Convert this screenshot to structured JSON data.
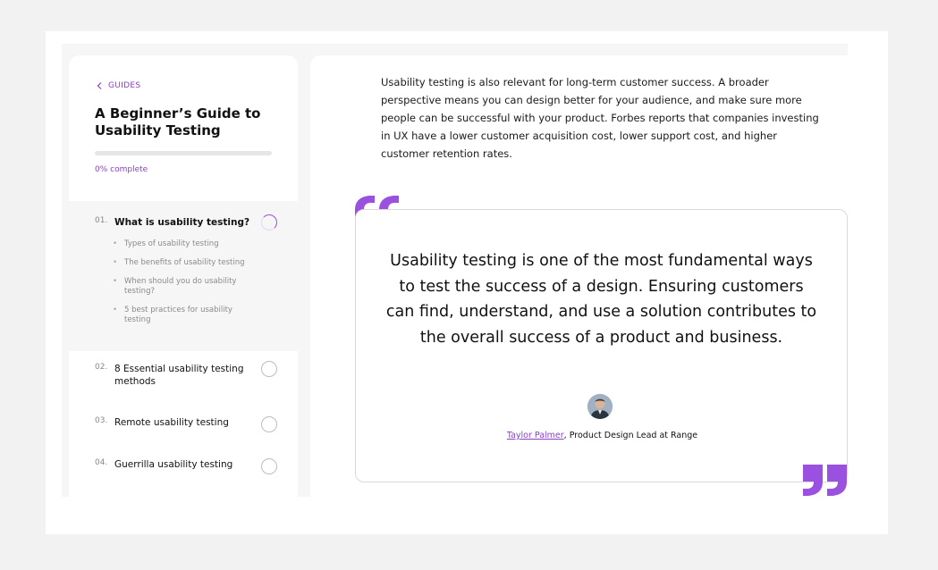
{
  "sidebar": {
    "back_label": "GUIDES",
    "title": "A Beginner’s Guide to Usability Testing",
    "progress_fraction": 0.0,
    "progress_text": "0% complete",
    "chapters": [
      {
        "number": "01.",
        "title": "What is usability testing?",
        "active": true,
        "subsections": [
          "Types of usability testing",
          "The benefits of  usability testing",
          "When should you do usability testing?",
          "5 best practices for usability testing"
        ]
      },
      {
        "number": "02.",
        "title": "8 Essential usability testing methods",
        "active": false
      },
      {
        "number": "03.",
        "title": "Remote usability testing",
        "active": false
      },
      {
        "number": "04.",
        "title": "Guerrilla usability  testing",
        "active": false
      }
    ]
  },
  "article": {
    "paragraph": "Usability testing is also relevant for long-term customer success. A broader perspective means you can design better for your audience, and make sure more people can be successful with your product. Forbes reports that companies investing in UX have a lower customer acquisition cost, lower support cost, and higher customer retention rates.",
    "quote": {
      "text": "Usability testing is one of the most fundamental ways to test the success of a design. Ensuring customers can find, understand, and use a solution contributes to the overall success of a product and business.",
      "author_name": "Taylor Palmer",
      "author_role": ", Product Design Lead at Range"
    }
  },
  "colors": {
    "accent": "#9b51e0",
    "accent_text": "#8a3fc7"
  }
}
